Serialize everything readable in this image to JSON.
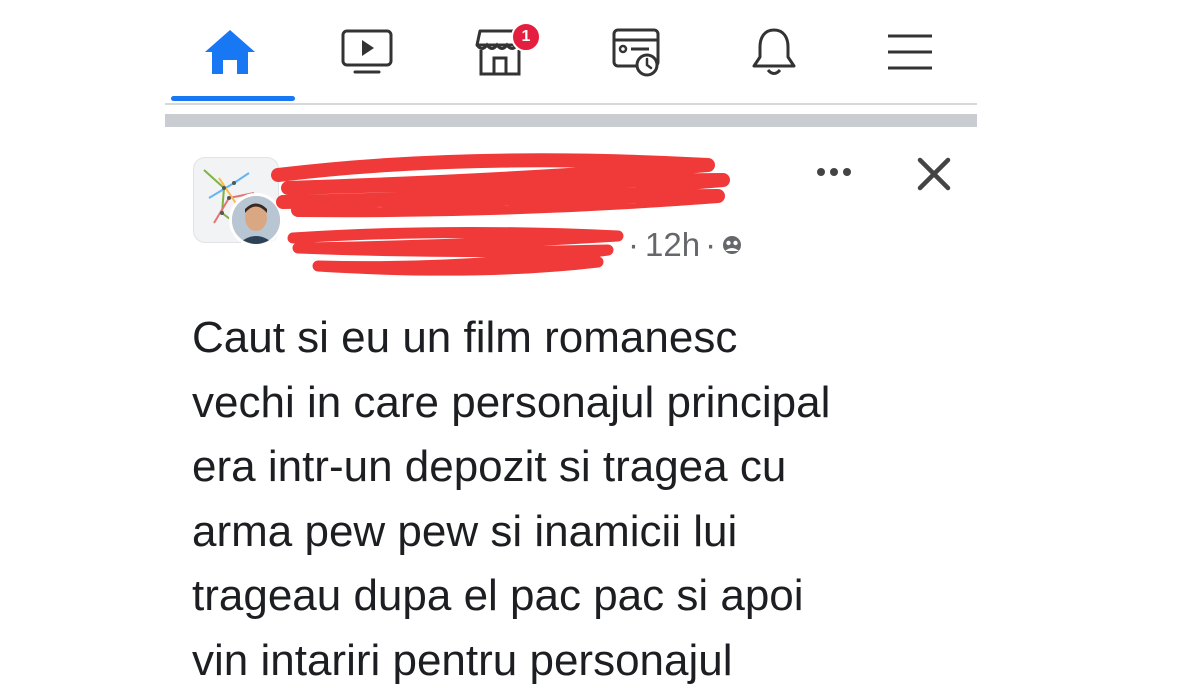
{
  "nav": {
    "items": [
      {
        "id": "home",
        "icon": "home-icon",
        "active": true
      },
      {
        "id": "watch",
        "icon": "video-icon"
      },
      {
        "id": "marketplace",
        "icon": "marketplace-icon",
        "badge": "1"
      },
      {
        "id": "memories",
        "icon": "memories-icon"
      },
      {
        "id": "notifications",
        "icon": "bell-icon"
      },
      {
        "id": "menu",
        "icon": "hamburger-icon"
      }
    ],
    "accent": "#1877f2",
    "badge_color": "#e41e3f"
  },
  "post": {
    "time": "12h",
    "separator": "·",
    "privacy_icon": "group-privacy-icon",
    "text": "Caut si eu un film romanesc\nvechi in care personajul principal\nera intr-un depozit si tragea cu\narma pew pew si inamicii lui\ntrageau dupa el pac pac si apoi\nvin intariri pentru personajul",
    "redaction_color": "#f03a3a"
  }
}
